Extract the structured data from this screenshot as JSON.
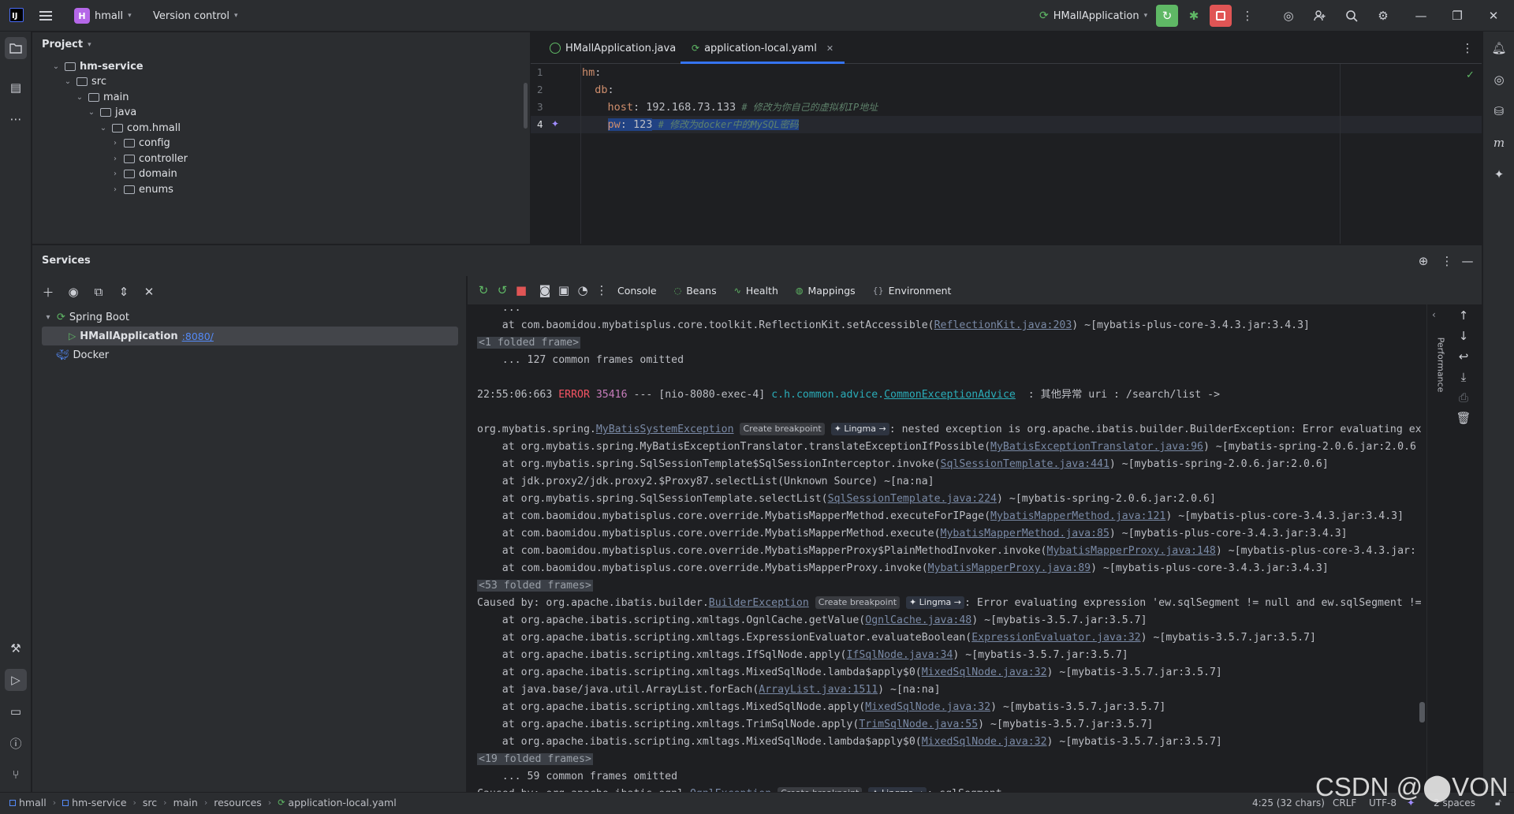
{
  "titlebar": {
    "project_badge": "H",
    "project_name": "hmall",
    "vcs_label": "Version control",
    "run_config": "HMallApplication"
  },
  "project_panel": {
    "title": "Project",
    "tree": [
      {
        "label": "hm-service",
        "depth": 0,
        "expanded": true,
        "bold": true
      },
      {
        "label": "src",
        "depth": 1,
        "expanded": true
      },
      {
        "label": "main",
        "depth": 2,
        "expanded": true
      },
      {
        "label": "java",
        "depth": 3,
        "expanded": true
      },
      {
        "label": "com.hmall",
        "depth": 4,
        "expanded": true
      },
      {
        "label": "config",
        "depth": 5,
        "expanded": false
      },
      {
        "label": "controller",
        "depth": 5,
        "expanded": false
      },
      {
        "label": "domain",
        "depth": 5,
        "expanded": false
      },
      {
        "label": "enums",
        "depth": 5,
        "expanded": false
      }
    ]
  },
  "editor": {
    "tabs": [
      {
        "label": "HMallApplication.java",
        "active": false
      },
      {
        "label": "application-local.yaml",
        "active": true
      }
    ],
    "lines": [
      {
        "num": "1",
        "key": "hm",
        "value": "",
        "comment": ""
      },
      {
        "num": "2",
        "key": "db",
        "value": "",
        "comment": ""
      },
      {
        "num": "3",
        "key": "host",
        "value": "192.168.73.133",
        "comment": "# 修改为你自己的虚拟机IP地址"
      },
      {
        "num": "4",
        "key": "pw",
        "value": "123",
        "comment": "# 修改为docker中的MySQL密码"
      }
    ]
  },
  "services": {
    "title": "Services",
    "tree": {
      "group": "Spring Boot",
      "app": "HMallApplication",
      "port": ":8080/",
      "docker": "Docker"
    },
    "console_tabs": [
      "Console",
      "Beans",
      "Health",
      "Mappings",
      "Environment"
    ],
    "side_label": "Performance"
  },
  "console": {
    "chips": {
      "breakpoint": "Create breakpoint",
      "lingma": "Lingma →"
    },
    "line1_pre": "    at com.baomidou.mybatisplus.core.toolkit.ReflectionKit.setAccessible(",
    "line1_link": "ReflectionKit.java:203",
    "line1_post": ") ~[mybatis-plus-core-3.4.3.jar:3.4.3]",
    "fold1": "<1 folded frame>",
    "omit1": "    ... 127 common frames omitted",
    "log_time": "22:55:06:663 ",
    "log_level": "ERROR",
    "log_pid": " 35416",
    "log_mid": " --- [nio-8080-exec-4] ",
    "log_class": "c.h.common.advice.",
    "log_link": "CommonExceptionAdvice",
    "log_msg": "  : 其他异常 uri : /search/list ->",
    "ex1_pre": "org.mybatis.spring.",
    "ex1_link": "MyBatisSystemException",
    "ex1_post": ": nested exception is org.apache.ibatis.builder.BuilderException: Error evaluating ex",
    "frames1": [
      {
        "pre": "    at org.mybatis.spring.MyBatisExceptionTranslator.translateExceptionIfPossible(",
        "link": "MyBatisExceptionTranslator.java:96",
        "post": ") ~[mybatis-spring-2.0.6.jar:2.0.6"
      },
      {
        "pre": "    at org.mybatis.spring.SqlSessionTemplate$SqlSessionInterceptor.invoke(",
        "link": "SqlSessionTemplate.java:441",
        "post": ") ~[mybatis-spring-2.0.6.jar:2.0.6]"
      },
      {
        "pre": "    at jdk.proxy2/jdk.proxy2.$Proxy87.selectList(Unknown Source) ~[na:na]",
        "link": "",
        "post": ""
      },
      {
        "pre": "    at org.mybatis.spring.SqlSessionTemplate.selectList(",
        "link": "SqlSessionTemplate.java:224",
        "post": ") ~[mybatis-spring-2.0.6.jar:2.0.6]"
      },
      {
        "pre": "    at com.baomidou.mybatisplus.core.override.MybatisMapperMethod.executeForIPage(",
        "link": "MybatisMapperMethod.java:121",
        "post": ") ~[mybatis-plus-core-3.4.3.jar:3.4.3]"
      },
      {
        "pre": "    at com.baomidou.mybatisplus.core.override.MybatisMapperMethod.execute(",
        "link": "MybatisMapperMethod.java:85",
        "post": ") ~[mybatis-plus-core-3.4.3.jar:3.4.3]"
      },
      {
        "pre": "    at com.baomidou.mybatisplus.core.override.MybatisMapperProxy$PlainMethodInvoker.invoke(",
        "link": "MybatisMapperProxy.java:148",
        "post": ") ~[mybatis-plus-core-3.4.3.jar:"
      },
      {
        "pre": "    at com.baomidou.mybatisplus.core.override.MybatisMapperProxy.invoke(",
        "link": "MybatisMapperProxy.java:89",
        "post": ") ~[mybatis-plus-core-3.4.3.jar:3.4.3]"
      }
    ],
    "fold2": "<53 folded frames>",
    "ex2_pre": "Caused by: org.apache.ibatis.builder.",
    "ex2_link": "BuilderException",
    "ex2_post": ": Error evaluating expression 'ew.sqlSegment != null and ew.sqlSegment !=",
    "frames2": [
      {
        "pre": "    at org.apache.ibatis.scripting.xmltags.OgnlCache.getValue(",
        "link": "OgnlCache.java:48",
        "post": ") ~[mybatis-3.5.7.jar:3.5.7]"
      },
      {
        "pre": "    at org.apache.ibatis.scripting.xmltags.ExpressionEvaluator.evaluateBoolean(",
        "link": "ExpressionEvaluator.java:32",
        "post": ") ~[mybatis-3.5.7.jar:3.5.7]"
      },
      {
        "pre": "    at org.apache.ibatis.scripting.xmltags.IfSqlNode.apply(",
        "link": "IfSqlNode.java:34",
        "post": ") ~[mybatis-3.5.7.jar:3.5.7]"
      },
      {
        "pre": "    at org.apache.ibatis.scripting.xmltags.MixedSqlNode.lambda$apply$0(",
        "link": "MixedSqlNode.java:32",
        "post": ") ~[mybatis-3.5.7.jar:3.5.7]"
      },
      {
        "pre": "    at java.base/java.util.ArrayList.forEach(",
        "link": "ArrayList.java:1511",
        "post": ") ~[na:na]"
      },
      {
        "pre": "    at org.apache.ibatis.scripting.xmltags.MixedSqlNode.apply(",
        "link": "MixedSqlNode.java:32",
        "post": ") ~[mybatis-3.5.7.jar:3.5.7]"
      },
      {
        "pre": "    at org.apache.ibatis.scripting.xmltags.TrimSqlNode.apply(",
        "link": "TrimSqlNode.java:55",
        "post": ") ~[mybatis-3.5.7.jar:3.5.7]"
      },
      {
        "pre": "    at org.apache.ibatis.scripting.xmltags.MixedSqlNode.lambda$apply$0(",
        "link": "MixedSqlNode.java:32",
        "post": ") ~[mybatis-3.5.7.jar:3.5.7]"
      }
    ],
    "fold3": "<19 folded frames>",
    "omit2": "    ... 59 common frames omitted",
    "ex3_pre": "Caused by: org.apache.ibatis.ognl.",
    "ex3_link": "OgnlException",
    "ex3_post": ": sqlSegment"
  },
  "statusbar": {
    "crumbs": [
      "hmall",
      "hm-service",
      "src",
      "main",
      "resources",
      "application-local.yaml"
    ],
    "position": "4:25 (32 chars)",
    "line_sep": "CRLF",
    "encoding": "UTF-8",
    "indent": "2 spaces"
  },
  "watermark": "CSDN @⬤VON",
  "colors": {
    "accent": "#3574f0",
    "run_green": "#5fb865",
    "stop_red": "#e05555",
    "key_orange": "#cf8e6d",
    "comment_gray": "#5f826b"
  }
}
